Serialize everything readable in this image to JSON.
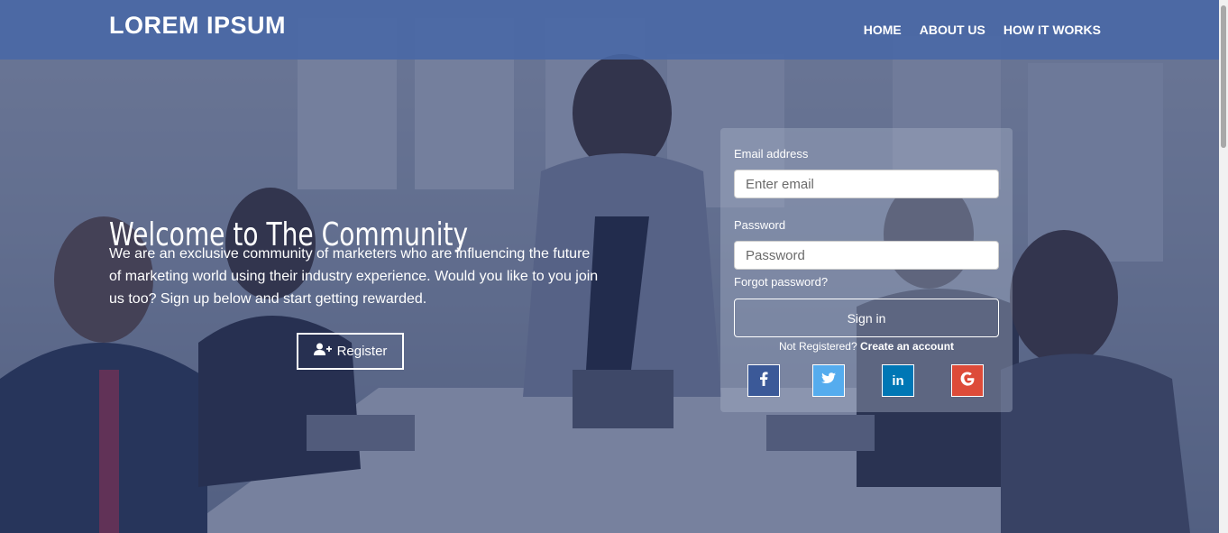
{
  "brand": "LOREM IPSUM",
  "nav": {
    "items": [
      {
        "label": "HOME"
      },
      {
        "label": "ABOUT US"
      },
      {
        "label": "HOW IT WORKS"
      }
    ]
  },
  "hero": {
    "title": "Welcome to The Community",
    "text": "We are an exclusive community of marketers who are influencing the future of marketing world using their industry experience. Would you like to you join us too? Sign up below and start getting rewarded.",
    "register_label": "Register",
    "register_icon": "user-plus-icon"
  },
  "login": {
    "email_label": "Email address",
    "email_placeholder": "Enter email",
    "email_value": "",
    "password_label": "Password",
    "password_placeholder": "Password",
    "password_value": "",
    "forgot_label": "Forgot password?",
    "signin_label": "Sign in",
    "not_registered": "Not Registered?",
    "create_account": "Create an account"
  },
  "social": [
    {
      "name": "facebook",
      "glyph": "f",
      "color": "#3b5998"
    },
    {
      "name": "twitter",
      "glyph": "twitter-bird",
      "color": "#55acee"
    },
    {
      "name": "linkedin",
      "glyph": "in",
      "color": "#0077b5"
    },
    {
      "name": "google",
      "glyph": "G",
      "color": "#dd4b39"
    }
  ],
  "colors": {
    "navbar": "#4868a6",
    "overlay": "#2d3c69"
  }
}
